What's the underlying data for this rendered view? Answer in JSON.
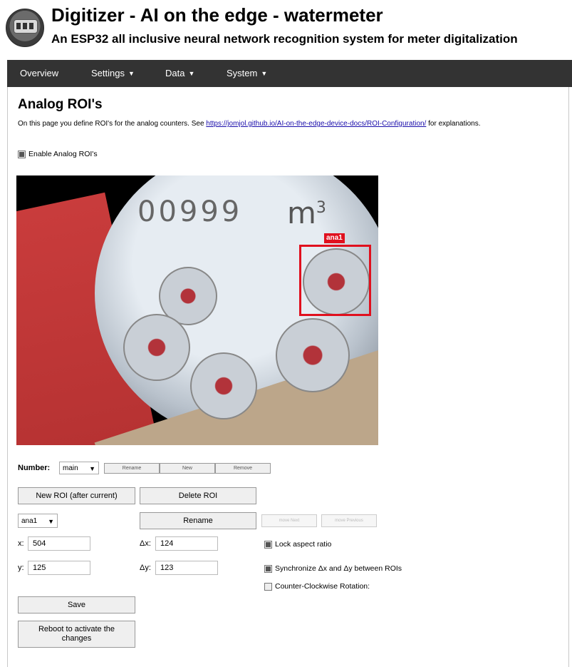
{
  "header": {
    "title": "Digitizer - AI on the edge - watermeter",
    "subtitle": "An ESP32 all inclusive neural network recognition system for meter digitalization"
  },
  "nav": {
    "overview": "Overview",
    "settings": "Settings",
    "data": "Data",
    "system": "System"
  },
  "page": {
    "heading": "Analog ROI's",
    "description_prefix": "On this page you define ROI's for the analog counters. See",
    "description_link": "https://jomjol.github.io/AI-on-the-edge-device-docs/ROI-Configuration/",
    "description_suffix": "for explanations.",
    "enable_label": "Enable Analog ROI's",
    "enable_checked": true
  },
  "camera": {
    "digits": "00999",
    "unit": "m",
    "unit_sup": "3",
    "roi_label": "ana1"
  },
  "number": {
    "label": "Number:",
    "selected": "main",
    "rename": "Rename",
    "new": "New",
    "remove": "Remove"
  },
  "roi": {
    "new_roi": "New ROI (after current)",
    "delete_roi": "Delete ROI",
    "selected": "ana1",
    "rename": "Rename",
    "move_next": "move Next",
    "move_previous": "move Previous",
    "x_label": "x:",
    "x_value": "504",
    "y_label": "y:",
    "y_value": "125",
    "dx_label": "Δx:",
    "dx_value": "124",
    "dy_label": "Δy:",
    "dy_value": "123",
    "lock_aspect": "Lock aspect ratio",
    "lock_checked": true,
    "sync_label": "Synchronize Δx and Δy between ROIs",
    "sync_checked": true,
    "ccw_label": "Counter-Clockwise Rotation:",
    "ccw_checked": false
  },
  "actions": {
    "save": "Save",
    "reboot": "Reboot to activate the changes"
  }
}
